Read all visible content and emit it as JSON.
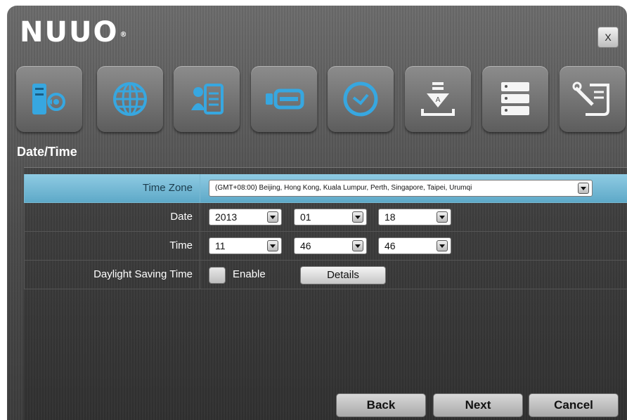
{
  "app": {
    "logo_text": "NUUO",
    "logo_mark": "®",
    "close_label": "X"
  },
  "toolbar": {
    "icons": [
      {
        "name": "server-settings-icon",
        "color": "#37a7e0"
      },
      {
        "name": "globe-network-icon",
        "color": "#37a7e0"
      },
      {
        "name": "user-certificate-icon",
        "color": "#37a7e0"
      },
      {
        "name": "storage-drive-icon",
        "color": "#37a7e0"
      },
      {
        "name": "clock-icon",
        "color": "#37a7e0"
      },
      {
        "name": "install-download-icon",
        "color": "#f5f5f5"
      },
      {
        "name": "server-rack-icon",
        "color": "#f5f5f5"
      },
      {
        "name": "tools-script-icon",
        "color": "#f5f5f5"
      }
    ]
  },
  "section": {
    "title": "Date/Time"
  },
  "form": {
    "timezone": {
      "label": "Time Zone",
      "value": "(GMT+08:00) Beijing, Hong Kong, Kuala Lumpur, Perth, Singapore, Taipei, Urumqi"
    },
    "date": {
      "label": "Date",
      "year": "2013",
      "month": "01",
      "day": "18"
    },
    "time": {
      "label": "Time",
      "hour": "11",
      "minute": "46",
      "second": "46"
    },
    "dst": {
      "label": "Daylight Saving Time",
      "enable_label": "Enable",
      "details_label": "Details"
    }
  },
  "footer": {
    "back_label": "Back",
    "next_label": "Next",
    "cancel_label": "Cancel"
  },
  "colors": {
    "selected_row": "#6fb7d4",
    "accent_icon": "#37a7e0"
  }
}
